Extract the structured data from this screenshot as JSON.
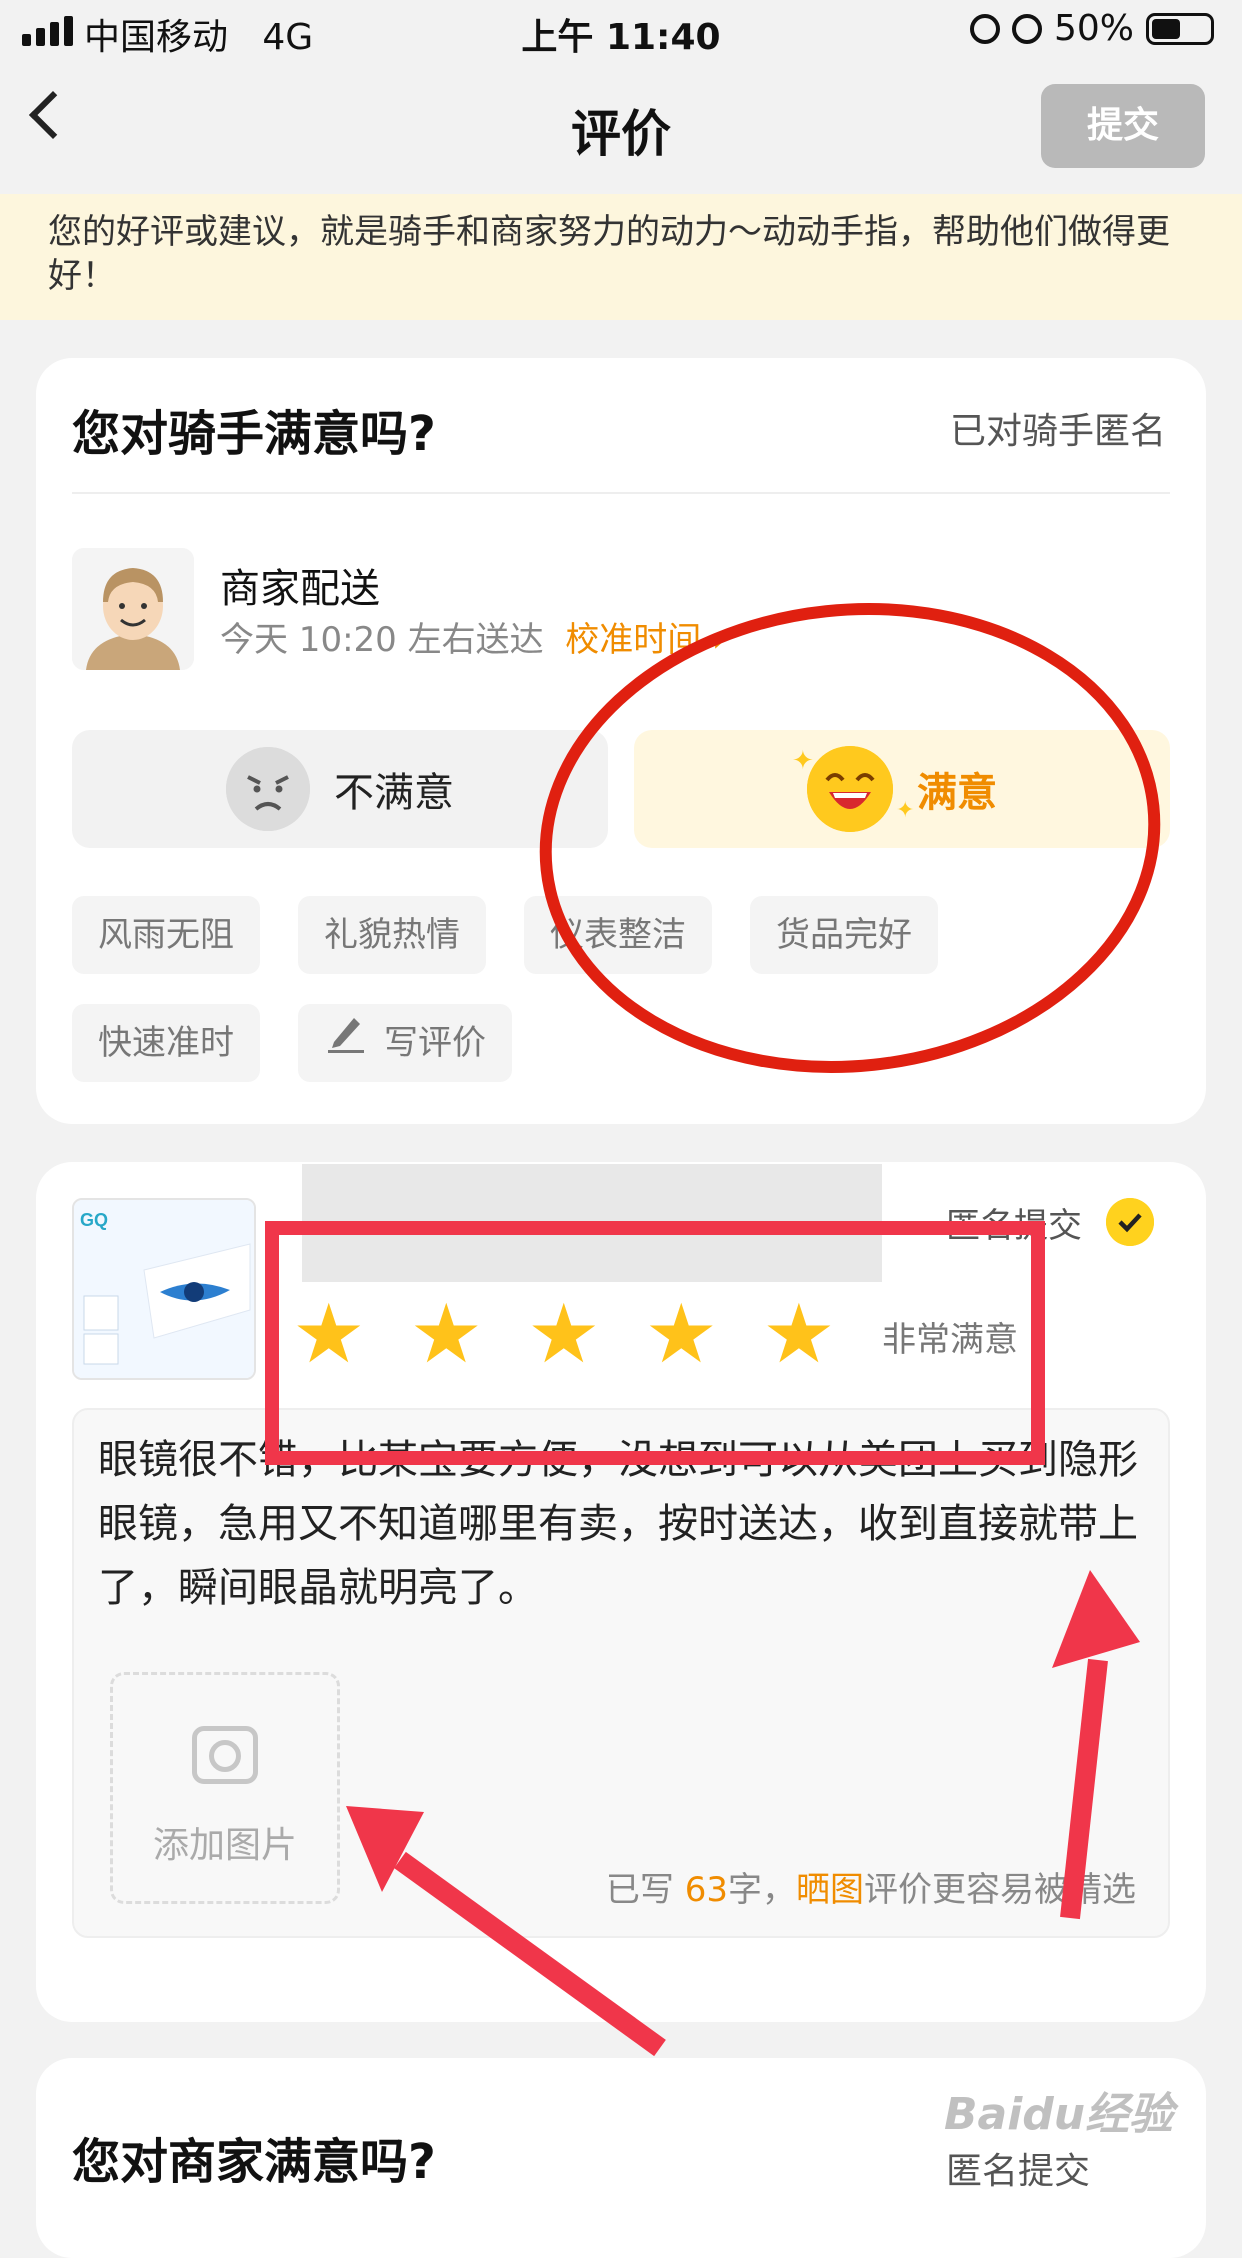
{
  "status_bar": {
    "carrier": "中国移动",
    "network": "4G",
    "time": "上午 11:40",
    "battery": "50%"
  },
  "header": {
    "title": "评价",
    "submit_label": "提交"
  },
  "notice": "您的好评或建议，就是骑手和商家努力的动力～动动手指，帮助他们做得更好！",
  "rider_card": {
    "title": "您对骑手满意吗?",
    "anonymous_label": "已对骑手匿名",
    "rider_name": "商家配送",
    "delivery_time": "今天 10:20 左右送达",
    "calibrate_link": "校准时间",
    "unsatisfied_label": "不满意",
    "satisfied_label": "满意",
    "tags": [
      "风雨无阻",
      "礼貌热情",
      "仪表整洁",
      "货品完好",
      "快速准时"
    ],
    "write_review_label": "写评价"
  },
  "product_card": {
    "anonymous_submit_label": "匿名提交",
    "rating": 5,
    "rating_max": 5,
    "rating_label": "非常满意",
    "review_text": "眼镜很不错，比某宝要方便，没想到可以从美团上买到隐形眼镜，急用又不知道哪里有卖，按时送达，收到直接就带上了，瞬间眼晶就明亮了。",
    "add_photo_label": "添加图片",
    "count_prefix": "已写",
    "char_count": "63",
    "count_mid": "字，",
    "photo_word": "晒图",
    "count_suffix": "评价更容易被精选"
  },
  "merchant_card": {
    "title": "您对商家满意吗?",
    "anonymous_submit_label": "匿名提交"
  },
  "watermark": "Baidu经验",
  "colors": {
    "accent": "#f08c00",
    "star": "#ffc21a",
    "annotation_red": "#e02010",
    "arrow_red": "#f0364a"
  }
}
